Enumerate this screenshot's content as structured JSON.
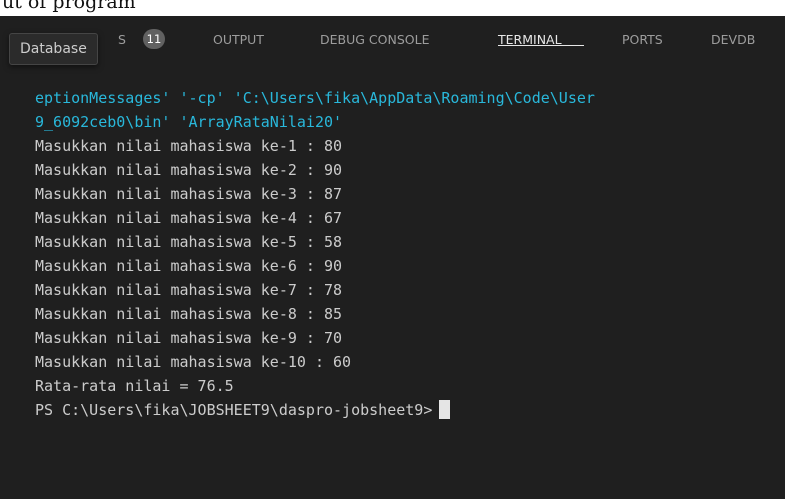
{
  "top_strip": {
    "text": "ut of program"
  },
  "tooltip": {
    "text": "Database"
  },
  "tabs": [
    {
      "label": "PROBLEMS",
      "visible_label": "S",
      "id": "problems"
    },
    {
      "label": "OUTPUT",
      "id": "output"
    },
    {
      "label": "DEBUG CONSOLE",
      "id": "debug-console"
    },
    {
      "label": "TERMINAL",
      "id": "terminal",
      "active": true
    },
    {
      "label": "PORTS",
      "id": "ports"
    },
    {
      "label": "DEVDB",
      "id": "devdb"
    }
  ],
  "problems_count": "11",
  "colors": {
    "panel_bg": "#1f1f1f",
    "text": "#cccccc",
    "cyan": "#29b8db",
    "active_tab": "#e7e7e7",
    "inactive_tab": "#9d9d9d"
  },
  "terminal": {
    "lines": [
      {
        "text": "eptionMessages' '-cp' 'C:\\Users\\fika\\AppData\\Roaming\\Code\\User",
        "style": "cyan"
      },
      {
        "text": "9_6092ceb0\\bin' 'ArrayRataNilai20'",
        "style": "cyan"
      },
      {
        "text": "Masukkan nilai mahasiswa ke-1 : 80"
      },
      {
        "text": "Masukkan nilai mahasiswa ke-2 : 90"
      },
      {
        "text": "Masukkan nilai mahasiswa ke-3 : 87"
      },
      {
        "text": "Masukkan nilai mahasiswa ke-4 : 67"
      },
      {
        "text": "Masukkan nilai mahasiswa ke-5 : 58"
      },
      {
        "text": "Masukkan nilai mahasiswa ke-6 : 90"
      },
      {
        "text": "Masukkan nilai mahasiswa ke-7 : 78"
      },
      {
        "text": "Masukkan nilai mahasiswa ke-8 : 85"
      },
      {
        "text": "Masukkan nilai mahasiswa ke-9 : 70"
      },
      {
        "text": "Masukkan nilai mahasiswa ke-10 : 60"
      },
      {
        "text": "Rata-rata nilai = 76.5"
      }
    ],
    "prompt": "PS C:\\Users\\fika\\JOBSHEET9\\daspro-jobsheet9>"
  }
}
